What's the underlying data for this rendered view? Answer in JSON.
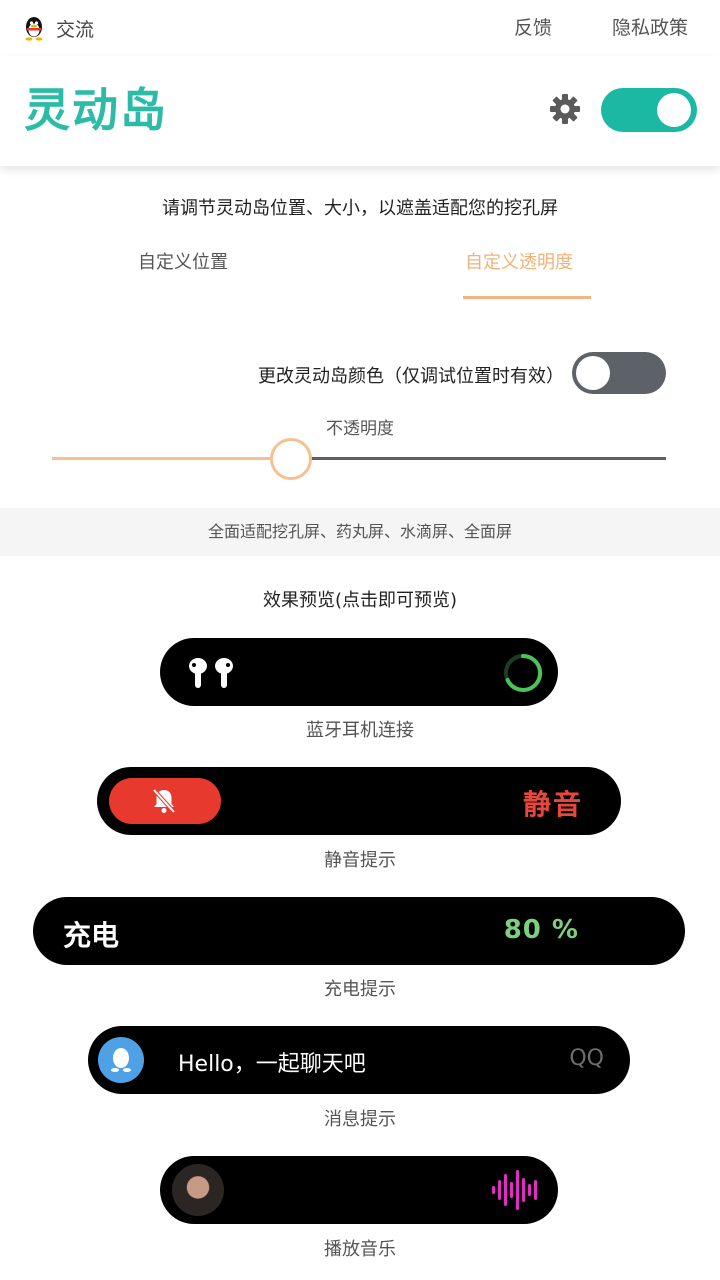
{
  "topbar": {
    "qq_label": "交流",
    "feedback": "反馈",
    "privacy": "隐私政策"
  },
  "header": {
    "title": "灵动岛",
    "toggle_on": true
  },
  "instruction": "请调节灵动岛位置、大小，以遮盖适配您的挖孔屏",
  "tabs": [
    {
      "label": "自定义位置",
      "active": false
    },
    {
      "label": "自定义透明度",
      "active": true
    }
  ],
  "color_option": {
    "label": "更改灵动岛颜色（仅调试位置时有效）",
    "enabled": false
  },
  "opacity": {
    "label": "不透明度",
    "value": 0.39
  },
  "support_text": "全面适配挖孔屏、药丸屏、水滴屏、全面屏",
  "preview": {
    "title": "效果预览(点击即可预览)",
    "bluetooth": {
      "caption": "蓝牙耳机连接"
    },
    "mute": {
      "text": "静音",
      "caption": "静音提示"
    },
    "charge": {
      "label": "充电",
      "percent": "80 %",
      "caption": "充电提示"
    },
    "message": {
      "text": "Hello，一起聊天吧",
      "app": "QQ",
      "caption": "消息提示"
    },
    "music": {
      "caption": "播放音乐"
    }
  },
  "colors": {
    "accent": "#2bbba7",
    "tab_active": "#f0b27a",
    "mute_red": "#e8392f",
    "charge_green": "#7fd07c"
  }
}
